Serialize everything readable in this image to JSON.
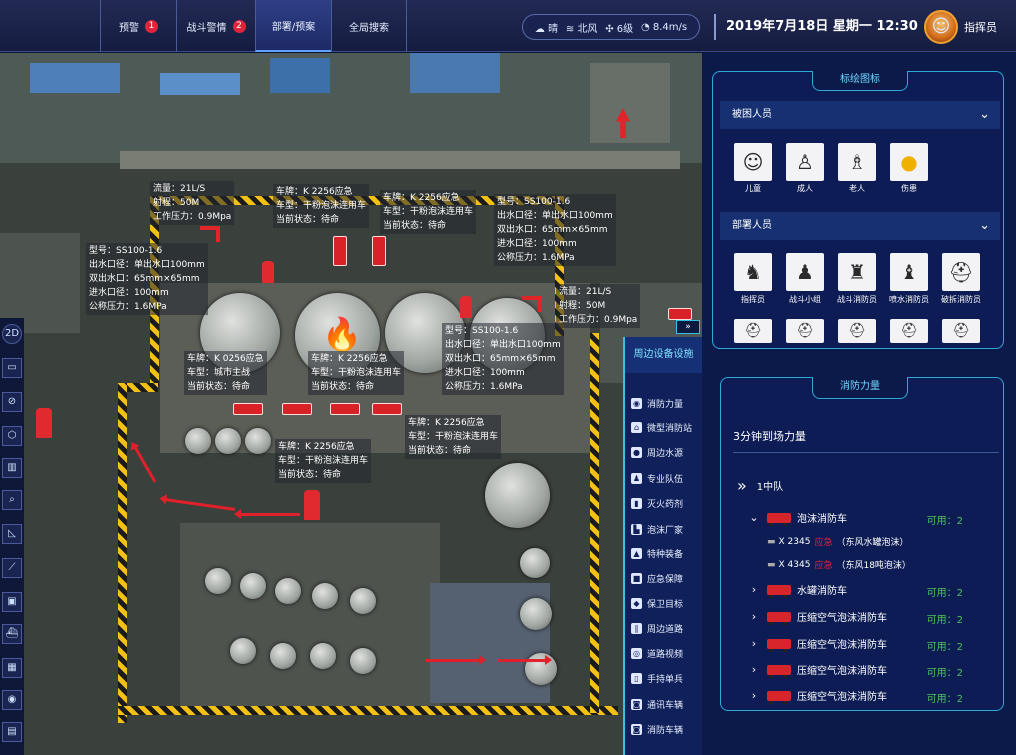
{
  "nav": {
    "tabs": [
      {
        "label": "预警",
        "badge": "1"
      },
      {
        "label": "战斗警情",
        "badge": "2"
      },
      {
        "label": "部署/预案"
      },
      {
        "label": "全局搜索"
      }
    ]
  },
  "weather": {
    "condition": "晴",
    "wind_dir": "北风",
    "wind_level": "6级",
    "wind_speed": "8.4m/s"
  },
  "datetime": "2019年7月18日 星期一 12:30",
  "user": {
    "name": "指挥员"
  },
  "map": {
    "info": {
      "flow_a": "流量：21L/S\n射程：50M\n工作压力：0.9Mpa",
      "truck_top1": "车牌：K 2256应急\n车型：干粉泡沫连用车\n当前状态：待命",
      "truck_top2": "车牌：K 2256应急\n车型：干粉泡沫连用车\n当前状态：待命",
      "hydrant_top": "型号：SS100-1.6\n出水口径：单出水口100mm\n双出水口：65mm×65mm\n进水口径：100mm\n公称压力：1.6MPa",
      "hydrant_left": "型号：SS100-1.6\n出水口径：单出水口100mm\n双出水口：65mm×65mm\n进水口径：100mm\n公称压力：1.6MPa",
      "flow_b": "流量：21L/S\n射程：50M\n工作压力：0.9Mpa",
      "hydrant_mid": "型号：SS100-1.6\n出水口径：单出水口100mm\n双出水口：65mm×65mm\n进水口径：100mm\n公称压力：1.6MPa",
      "truck_mid1": "车牌：K 0256应急\n车型：城市主战\n当前状态：待命",
      "truck_mid2": "车牌：K 2256应急\n车型：干粉泡沫连用车\n当前状态：待命",
      "truck_low1": "车牌：K 2256应急\n车型：干粉泡沫连用车\n当前状态：待命",
      "truck_low2": "车牌：K 2256应急\n车型：干粉泡沫连用车\n当前状态：待命"
    },
    "tools": [
      "2D",
      "▭",
      "⊘",
      "⬡",
      "▥",
      "⌕",
      "◺",
      "⟋",
      "▣",
      "⛴",
      "▦",
      "◉",
      "▤"
    ],
    "collapse_label": "»"
  },
  "facilities": {
    "title": "周边设备设施",
    "items": [
      "消防力量",
      "微型消防站",
      "周边水源",
      "专业队伍",
      "灭火药剂",
      "泡沫厂家",
      "特种装备",
      "应急保障",
      "保卫目标",
      "周边道路",
      "道路视频",
      "手持单兵",
      "通讯车辆",
      "消防车辆"
    ]
  },
  "legend": {
    "title": "标绘图标",
    "trapped": {
      "title": "被困人员",
      "items": [
        {
          "label": "儿童",
          "icon": "child-icon"
        },
        {
          "label": "成人",
          "icon": "adult-icon"
        },
        {
          "label": "老人",
          "icon": "elderly-icon"
        },
        {
          "label": "伤患",
          "icon": "injured-icon"
        }
      ]
    },
    "deployed": {
      "title": "部署人员",
      "items": [
        {
          "label": "指挥员",
          "icon": "commander-icon"
        },
        {
          "label": "战斗小组",
          "icon": "combat-team-icon"
        },
        {
          "label": "战斗消防员",
          "icon": "combat-firefighter-icon"
        },
        {
          "label": "喷水消防员",
          "icon": "spray-firefighter-icon"
        },
        {
          "label": "破拆消防员",
          "icon": "demolition-firefighter-icon"
        }
      ]
    }
  },
  "force": {
    "title": "消防力量",
    "subtitle": "3分钟到场力量",
    "team": "1中队",
    "groups": [
      {
        "name": "泡沫消防车",
        "avail": "可用：2",
        "expanded": true,
        "vehicles": [
          {
            "plate": "X 2345",
            "tag": "应急",
            "desc": "（东风水罐泡沫）"
          },
          {
            "plate": "X 4345",
            "tag": "应急",
            "desc": "（东风18吨泡沫）"
          }
        ]
      },
      {
        "name": "水罐消防车",
        "avail": "可用：2"
      },
      {
        "name": "压缩空气泡沫消防车",
        "avail": "可用：2"
      },
      {
        "name": "压缩空气泡沫消防车",
        "avail": "可用：2"
      },
      {
        "name": "压缩空气泡沫消防车",
        "avail": "可用：2"
      },
      {
        "name": "压缩空气泡沫消防车",
        "avail": "可用：2"
      }
    ]
  },
  "colors": {
    "accent": "#2fa8d8",
    "alert": "#e0243a",
    "available": "#4cc25a",
    "hazard": "#f3c114"
  }
}
